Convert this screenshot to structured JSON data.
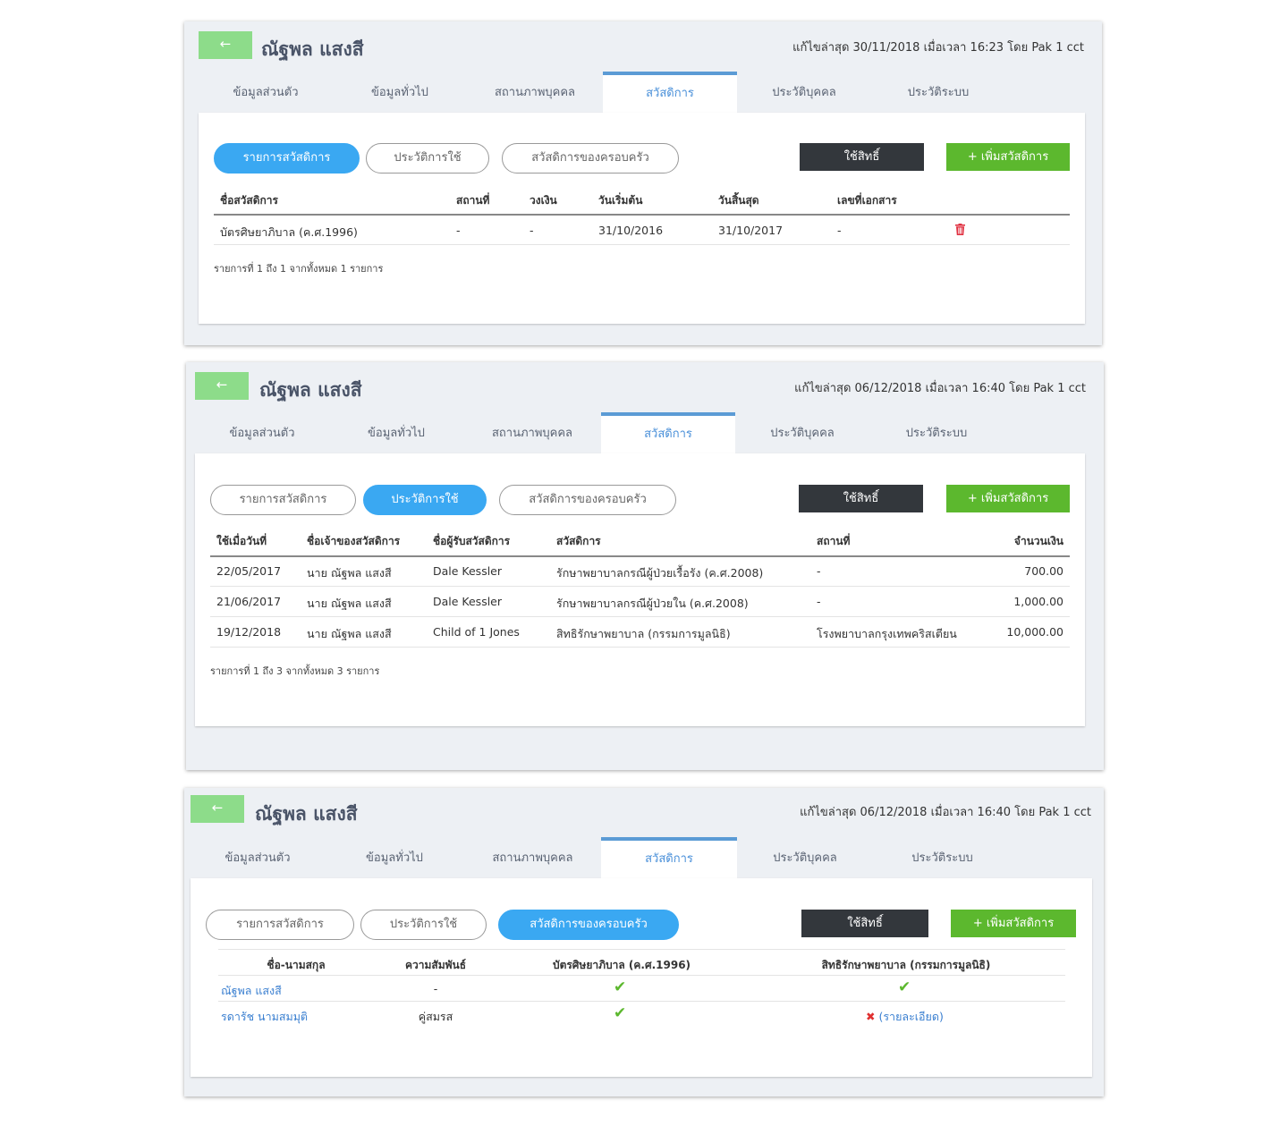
{
  "common": {
    "back_glyph": "←",
    "person_name": "ณัฐพล แสงสี",
    "tabs": [
      "ข้อมูลส่วนตัว",
      "ข้อมูลทั่วไป",
      "สถานภาพบุคคล",
      "สวัสดิการ",
      "ประวัติบุคคล",
      "ประวัติระบบ"
    ],
    "subtabs": [
      "รายการสวัสดิการ",
      "ประวัติการใช้",
      "สวัสดิการของครอบครัว"
    ],
    "use_button": "ใช้สิทธิ์",
    "add_button": "+ เพิ่มสวัสดิการ"
  },
  "panel1": {
    "meta": "แก้ไขล่าสุด 30/11/2018 เมื่อเวลา 16:23 โดย Pak 1 cct",
    "columns": [
      "ชื่อสวัสดิการ",
      "สถานที่",
      "วงเงิน",
      "วันเริ่มต้น",
      "วันสิ้นสุด",
      "เลขที่เอกสาร"
    ],
    "rows": [
      {
        "name": "บัตรศิษยาภิบาล (ค.ศ.1996)",
        "place": "-",
        "limit": "-",
        "start": "31/10/2016",
        "end": "31/10/2017",
        "doc": "-"
      }
    ],
    "footer": "รายการที่ 1 ถึง 1 จากทั้งหมด 1 รายการ"
  },
  "panel2": {
    "meta": "แก้ไขล่าสุด 06/12/2018 เมื่อเวลา 16:40 โดย Pak 1 cct",
    "columns": [
      "ใช้เมื่อวันที่",
      "ชื่อเจ้าของสวัสดิการ",
      "ชื่อผู้รับสวัสดิการ",
      "สวัสดิการ",
      "สถานที่",
      "จำนวนเงิน"
    ],
    "rows": [
      {
        "date": "22/05/2017",
        "owner": "นาย ณัฐพล แสงสี",
        "receiver": "Dale Kessler",
        "welfare": "รักษาพยาบาลกรณีผู้ป่วยเรื้อรัง (ค.ศ.2008)",
        "place": "-",
        "amount": "700.00"
      },
      {
        "date": "21/06/2017",
        "owner": "นาย ณัฐพล แสงสี",
        "receiver": "Dale Kessler",
        "welfare": "รักษาพยาบาลกรณีผู้ป่วยใน (ค.ศ.2008)",
        "place": "-",
        "amount": "1,000.00"
      },
      {
        "date": "19/12/2018",
        "owner": "นาย ณัฐพล แสงสี",
        "receiver": "Child of 1 Jones",
        "welfare": "สิทธิรักษาพยาบาล (กรรมการมูลนิธิ)",
        "place": "โรงพยาบาลกรุงเทพคริสเตียน",
        "amount": "10,000.00"
      }
    ],
    "footer": "รายการที่ 1 ถึง 3 จากทั้งหมด 3 รายการ"
  },
  "panel3": {
    "meta": "แก้ไขล่าสุด 06/12/2018 เมื่อเวลา 16:40 โดย Pak 1 cct",
    "columns": [
      "ชื่อ-นามสกุล",
      "ความสัมพันธ์",
      "บัตรศิษยาภิบาล (ค.ศ.1996)",
      "สิทธิรักษาพยาบาล (กรรมการมูลนิธิ)"
    ],
    "rows": [
      {
        "name": "ณัฐพล แสงสี",
        "relation": "-",
        "card_1996": "✔",
        "medical": "✔",
        "medical_detail": ""
      },
      {
        "name": "รดารัช นามสมมุติ",
        "relation": "คู่สมรส",
        "card_1996": "✔",
        "medical": "✖",
        "medical_detail": "(รายละเอียด)"
      }
    ]
  },
  "colors": {
    "accent_blue": "#3aa8f2",
    "tab_active": "#5b9bd5",
    "add_green": "#5cb82e",
    "back_green": "#8ddc8a",
    "dark_button": "#33373c",
    "delete_red": "#e03040"
  },
  "icons": {
    "back": "arrow-left-icon",
    "delete": "trash-icon",
    "check": "check-icon",
    "cross": "cross-icon"
  }
}
